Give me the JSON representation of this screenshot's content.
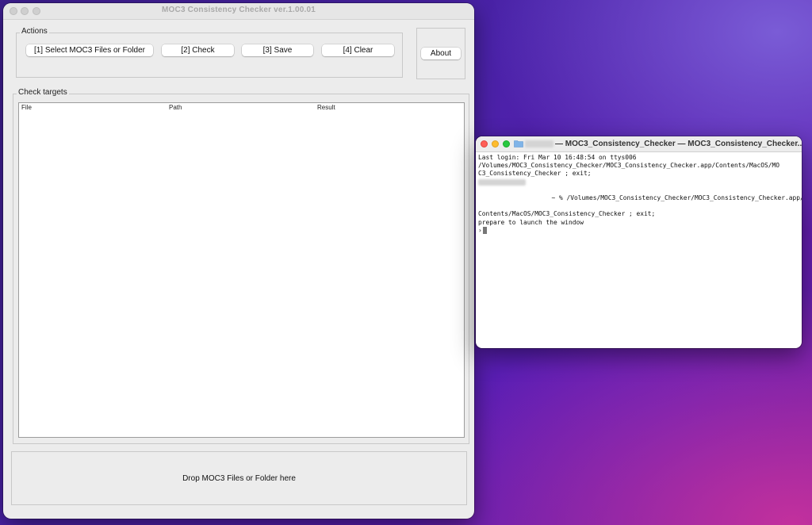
{
  "app": {
    "title": "MOC3 Consistency Checker ver.1.00.01",
    "actions": {
      "group_label": "Actions",
      "select_label": "[1] Select MOC3 Files or Folder",
      "check_label": "[2] Check",
      "save_label": "[3] Save",
      "clear_label": "[4] Clear"
    },
    "about_label": "About",
    "targets": {
      "group_label": "Check targets",
      "columns": [
        "File",
        "Path",
        "Result"
      ],
      "rows": []
    },
    "drop_label": "Drop MOC3 Files or Folder here"
  },
  "terminal": {
    "title": "— MOC3_Consistency_Checker — MOC3_Consistency_Checker...",
    "lines": [
      "Last login: Fri Mar 10 16:48:54 on ttys006",
      "/Volumes/MOC3_Consistency_Checker/MOC3_Consistency_Checker.app/Contents/MacOS/MO",
      "C3_Consistency_Checker ; exit;",
      "~ % /Volumes/MOC3_Consistency_Checker/MOC3_Consistency_Checker.app/",
      "Contents/MacOS/MOC3_Consistency_Checker ; exit;",
      "prepare to launch the window",
      "›"
    ]
  },
  "colors": {
    "traffic_red": "#ff5f57",
    "traffic_yellow": "#febc2e",
    "traffic_green": "#28c840"
  }
}
